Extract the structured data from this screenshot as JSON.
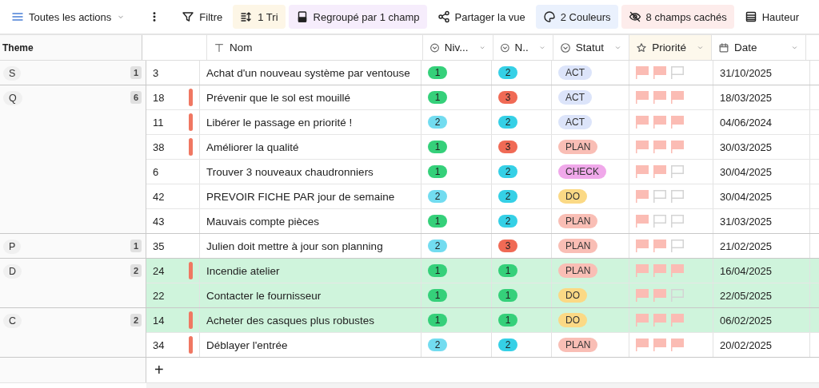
{
  "toolbar": {
    "view": {
      "label": "Toutes les actions"
    },
    "buttons": [
      {
        "kind": "filter",
        "label": "Filtre"
      },
      {
        "kind": "sort",
        "label": "1 Tri",
        "color": "#fdf6e6"
      },
      {
        "kind": "group",
        "label": "Regroupé par 1 champ",
        "color": "#f6edfc"
      },
      {
        "kind": "share",
        "label": "Partager la vue"
      },
      {
        "kind": "colors",
        "label": "2 Couleurs",
        "color": "#eaf1fd"
      },
      {
        "kind": "hide",
        "label": "8 champs cachés",
        "color": "#fdeceb"
      },
      {
        "kind": "height",
        "label": "Hauteur"
      }
    ]
  },
  "table": {
    "group_header": "Theme",
    "columns": [
      {
        "kind": "id"
      },
      {
        "kind": "text",
        "label": "Nom"
      },
      {
        "kind": "select",
        "label": "Niv..."
      },
      {
        "kind": "select",
        "label": "N.."
      },
      {
        "kind": "select",
        "label": "Statut"
      },
      {
        "kind": "rating",
        "label": "Priorité"
      },
      {
        "kind": "date",
        "label": "Date"
      }
    ],
    "groups": [
      {
        "theme": "S",
        "count": "1",
        "rows": [
          {
            "id": "3",
            "marked": false,
            "highlighted": false,
            "name": "Achat d'un nouveau système par ventouse",
            "niv": {
              "text": "1",
              "color": "#35d07a"
            },
            "n": {
              "text": "2",
              "color": "#35d0e6"
            },
            "status": {
              "text": "ACT",
              "color": "#dce4fa"
            },
            "stars": 2,
            "date": "31/10/2025"
          }
        ]
      },
      {
        "theme": "Q",
        "count": "6",
        "rows": [
          {
            "id": "18",
            "marked": true,
            "highlighted": false,
            "name": "Prévenir que le sol est mouillé",
            "niv": {
              "text": "1",
              "color": "#35d07a"
            },
            "n": {
              "text": "3",
              "color": "#f06a55"
            },
            "status": {
              "text": "ACT",
              "color": "#dce4fa"
            },
            "stars": 3,
            "date": "18/03/2025"
          },
          {
            "id": "11",
            "marked": true,
            "highlighted": false,
            "name": "Libérer le passage en priorité !",
            "niv": {
              "text": "2",
              "color": "#72dcf0"
            },
            "n": {
              "text": "2",
              "color": "#35d0e6"
            },
            "status": {
              "text": "ACT",
              "color": "#dce4fa"
            },
            "stars": 3,
            "date": "04/06/2024"
          },
          {
            "id": "38",
            "marked": true,
            "highlighted": false,
            "name": "Améliorer la qualité",
            "niv": {
              "text": "1",
              "color": "#35d07a"
            },
            "n": {
              "text": "3",
              "color": "#f06a55"
            },
            "status": {
              "text": "PLAN",
              "color": "#f9beb5"
            },
            "stars": 3,
            "date": "30/03/2025"
          },
          {
            "id": "6",
            "marked": false,
            "highlighted": false,
            "name": "Trouver 3 nouveaux chaudronniers",
            "niv": {
              "text": "1",
              "color": "#35d07a"
            },
            "n": {
              "text": "2",
              "color": "#35d0e6"
            },
            "status": {
              "text": "CHECK",
              "color": "#f0a8ea"
            },
            "stars": 2,
            "date": "30/04/2025"
          },
          {
            "id": "42",
            "marked": false,
            "highlighted": false,
            "name": "PREVOIR FICHE PAR jour de semaine",
            "niv": {
              "text": "2",
              "color": "#72dcf0"
            },
            "n": {
              "text": "2",
              "color": "#35d0e6"
            },
            "status": {
              "text": "DO",
              "color": "#fbd985"
            },
            "stars": 1,
            "date": "30/04/2025"
          },
          {
            "id": "43",
            "marked": false,
            "highlighted": false,
            "name": "Mauvais compte pièces",
            "niv": {
              "text": "1",
              "color": "#35d07a"
            },
            "n": {
              "text": "2",
              "color": "#35d0e6"
            },
            "status": {
              "text": "PLAN",
              "color": "#f9beb5"
            },
            "stars": 1,
            "date": "31/03/2025"
          }
        ]
      },
      {
        "theme": "P",
        "count": "1",
        "rows": [
          {
            "id": "35",
            "marked": false,
            "highlighted": false,
            "name": "Julien doit mettre à jour son planning",
            "niv": {
              "text": "2",
              "color": "#72dcf0"
            },
            "n": {
              "text": "3",
              "color": "#f06a55"
            },
            "status": {
              "text": "PLAN",
              "color": "#f9beb5"
            },
            "stars": 2,
            "date": "21/02/2025"
          }
        ]
      },
      {
        "theme": "D",
        "count": "2",
        "rows": [
          {
            "id": "24",
            "marked": true,
            "highlighted": true,
            "name": "Incendie atelier",
            "niv": {
              "text": "1",
              "color": "#35d07a"
            },
            "n": {
              "text": "1",
              "color": "#35d07a"
            },
            "status": {
              "text": "PLAN",
              "color": "#f9beb5"
            },
            "stars": 3,
            "date": "16/04/2025"
          },
          {
            "id": "22",
            "marked": false,
            "highlighted": true,
            "name": "Contacter le fournisseur",
            "niv": {
              "text": "1",
              "color": "#35d07a"
            },
            "n": {
              "text": "1",
              "color": "#35d07a"
            },
            "status": {
              "text": "DO",
              "color": "#fbd985"
            },
            "stars": 2,
            "date": "22/05/2025"
          }
        ]
      },
      {
        "theme": "C",
        "count": "2",
        "rows": [
          {
            "id": "14",
            "marked": true,
            "highlighted": true,
            "name": "Acheter des casques plus robustes",
            "niv": {
              "text": "1",
              "color": "#35d07a"
            },
            "n": {
              "text": "1",
              "color": "#35d07a"
            },
            "status": {
              "text": "DO",
              "color": "#fbd985"
            },
            "stars": 3,
            "date": "06/02/2025"
          },
          {
            "id": "34",
            "marked": true,
            "highlighted": false,
            "name": "Déblayer l'entrée",
            "niv": {
              "text": "2",
              "color": "#72dcf0"
            },
            "n": {
              "text": "2",
              "color": "#35d0e6"
            },
            "status": {
              "text": "PLAN",
              "color": "#f9beb5"
            },
            "stars": 3,
            "date": "20/02/2025"
          }
        ]
      }
    ],
    "add_row": {
      "label": "+"
    }
  }
}
